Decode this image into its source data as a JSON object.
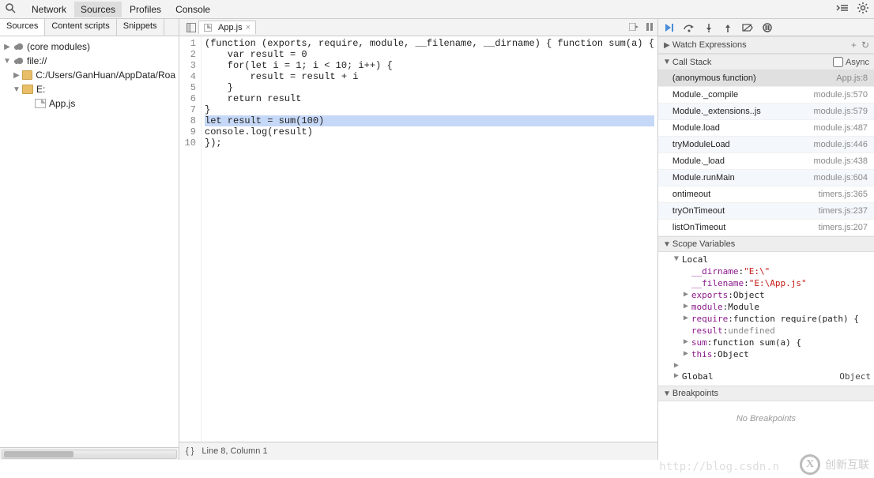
{
  "top": {
    "tabs": [
      "Network",
      "Sources",
      "Profiles",
      "Console"
    ],
    "active": 1
  },
  "left_tabs": {
    "items": [
      "Sources",
      "Content scripts",
      "Snippets"
    ],
    "active": 0
  },
  "tree": {
    "core": "(core modules)",
    "file_origin": "file://",
    "folder_c": "C:/Users/GanHuan/AppData/Roa",
    "folder_e": "E:",
    "app_file": "App.js"
  },
  "open_file": {
    "name": "App.js"
  },
  "code_lines": [
    "(function (exports, require, module, __filename, __dirname) { function sum(a) {",
    "    var result = 0",
    "    for(let i = 1; i < 10; i++) {",
    "        result = result + i",
    "    }",
    "    return result",
    "}",
    "let result = sum(100)",
    "console.log(result)",
    "});"
  ],
  "highlight_line": 8,
  "status": {
    "text": "Line 8, Column 1",
    "braces": "{ }"
  },
  "sections": {
    "watch": "Watch Expressions",
    "callstack": "Call Stack",
    "scope": "Scope Variables",
    "breakpoints": "Breakpoints",
    "async": "Async"
  },
  "callstack": [
    {
      "fn": "(anonymous function)",
      "loc": "App.js:8",
      "sel": true
    },
    {
      "fn": "Module._compile",
      "loc": "module.js:570"
    },
    {
      "fn": "Module._extensions..js",
      "loc": "module.js:579"
    },
    {
      "fn": "Module.load",
      "loc": "module.js:487"
    },
    {
      "fn": "tryModuleLoad",
      "loc": "module.js:446"
    },
    {
      "fn": "Module._load",
      "loc": "module.js:438"
    },
    {
      "fn": "Module.runMain",
      "loc": "module.js:604"
    },
    {
      "fn": "ontimeout",
      "loc": "timers.js:365"
    },
    {
      "fn": "tryOnTimeout",
      "loc": "timers.js:237"
    },
    {
      "fn": "listOnTimeout",
      "loc": "timers.js:207"
    }
  ],
  "scope": {
    "local_label": "Local",
    "dirname": {
      "k": "__dirname",
      "v": "\"E:\\\""
    },
    "filename": {
      "k": "__filename",
      "v": "\"E:\\App.js\""
    },
    "exports": {
      "k": "exports",
      "v": "Object"
    },
    "module": {
      "k": "module",
      "v": "Module"
    },
    "require": {
      "k": "require",
      "v": "function require(path) {"
    },
    "result": {
      "k": "result",
      "v": "undefined"
    },
    "sum": {
      "k": "sum",
      "v": "function sum(a) {"
    },
    "this": {
      "k": "this",
      "v": "Object"
    },
    "global": {
      "k": "Global",
      "v": "Object"
    }
  },
  "no_breakpoints": "No Breakpoints",
  "ghost": "http://blog.csdn.n",
  "brand": "创新互联"
}
